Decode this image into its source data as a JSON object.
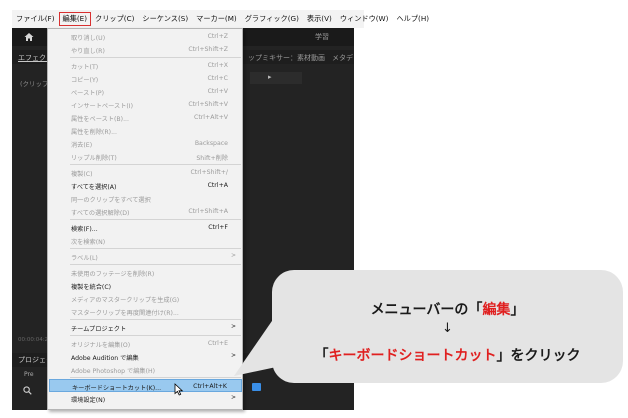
{
  "menubar": {
    "items": [
      "ファイル(F)",
      "編集(E)",
      "クリップ(C)",
      "シーケンス(S)",
      "マーカー(M)",
      "グラフィック(G)",
      "表示(V)",
      "ウィンドウ(W)",
      "ヘルプ(H)"
    ]
  },
  "app": {
    "workspace_label": "学習",
    "tab_effects": "エフェクト",
    "tab_right": "ップミキサー：素材動画",
    "tab_meta": "メタデ",
    "clip_label": "(クリップ",
    "timecode": "00:00:04:28",
    "project_label": "プロジェク",
    "project_row": "Pre",
    "right_arrow": "▸"
  },
  "menu": {
    "items": [
      {
        "label": "取り消し(U)",
        "shortcut": "Ctrl+Z",
        "disabled": true
      },
      {
        "label": "やり直し(R)",
        "shortcut": "Ctrl+Shift+Z",
        "disabled": true
      },
      {
        "label": "カット(T)",
        "shortcut": "Ctrl+X",
        "disabled": true
      },
      {
        "label": "コピー(Y)",
        "shortcut": "Ctrl+C",
        "disabled": true
      },
      {
        "label": "ペースト(P)",
        "shortcut": "Ctrl+V",
        "disabled": true
      },
      {
        "label": "インサートペースト(I)",
        "shortcut": "Ctrl+Shift+V",
        "disabled": true
      },
      {
        "label": "属性をペースト(B)...",
        "shortcut": "Ctrl+Alt+V",
        "disabled": true
      },
      {
        "label": "属性を削除(R)...",
        "shortcut": "",
        "disabled": true
      },
      {
        "label": "消去(E)",
        "shortcut": "Backspace",
        "disabled": true
      },
      {
        "label": "リップル削除(T)",
        "shortcut": "Shift+削除",
        "disabled": true
      },
      {
        "label": "複製(C)",
        "shortcut": "Ctrl+Shift+/",
        "disabled": true
      },
      {
        "label": "すべてを選択(A)",
        "shortcut": "Ctrl+A",
        "disabled": false
      },
      {
        "label": "同一のクリップをすべて選択",
        "shortcut": "",
        "disabled": true
      },
      {
        "label": "すべての選択解除(D)",
        "shortcut": "Ctrl+Shift+A",
        "disabled": true
      },
      {
        "label": "検索(F)...",
        "shortcut": "Ctrl+F",
        "disabled": false
      },
      {
        "label": "次を検索(N)",
        "shortcut": "",
        "disabled": true
      },
      {
        "label": "ラベル(L)",
        "shortcut": "",
        "disabled": true,
        "submenu": true
      },
      {
        "label": "未使用のフッテージを削除(R)",
        "shortcut": "",
        "disabled": true
      },
      {
        "label": "複製を統合(C)",
        "shortcut": "",
        "disabled": false
      },
      {
        "label": "メディアのマスタークリップを生成(G)",
        "shortcut": "",
        "disabled": true
      },
      {
        "label": "マスタークリップを再度関連付け(R)...",
        "shortcut": "",
        "disabled": true
      },
      {
        "label": "チームプロジェクト",
        "shortcut": "",
        "disabled": false,
        "submenu": true
      },
      {
        "label": "オリジナルを編集(O)",
        "shortcut": "Ctrl+E",
        "disabled": true
      },
      {
        "label": "Adobe Audition で編集",
        "shortcut": "",
        "disabled": false,
        "submenu": true
      },
      {
        "label": "Adobe Photoshop で編集(H)",
        "shortcut": "",
        "disabled": true
      },
      {
        "label": "キーボードショートカット(K)...",
        "shortcut": "Ctrl+Alt+K",
        "disabled": false,
        "highlighted": true
      },
      {
        "label": "環境設定(N)",
        "shortcut": "",
        "disabled": false,
        "submenu": true
      }
    ]
  },
  "callout": {
    "line1_prefix": "メニューバーの「",
    "line1_red": "編集",
    "line1_suffix": "」",
    "arrow": "↓",
    "line2_prefix": "「",
    "line2_red": "キーボードショートカット",
    "line2_suffix": "」をクリック"
  },
  "colors": {
    "highlight_red": "#e02020",
    "menu_highlight": "#99c9ef",
    "app_background": "#232323"
  }
}
